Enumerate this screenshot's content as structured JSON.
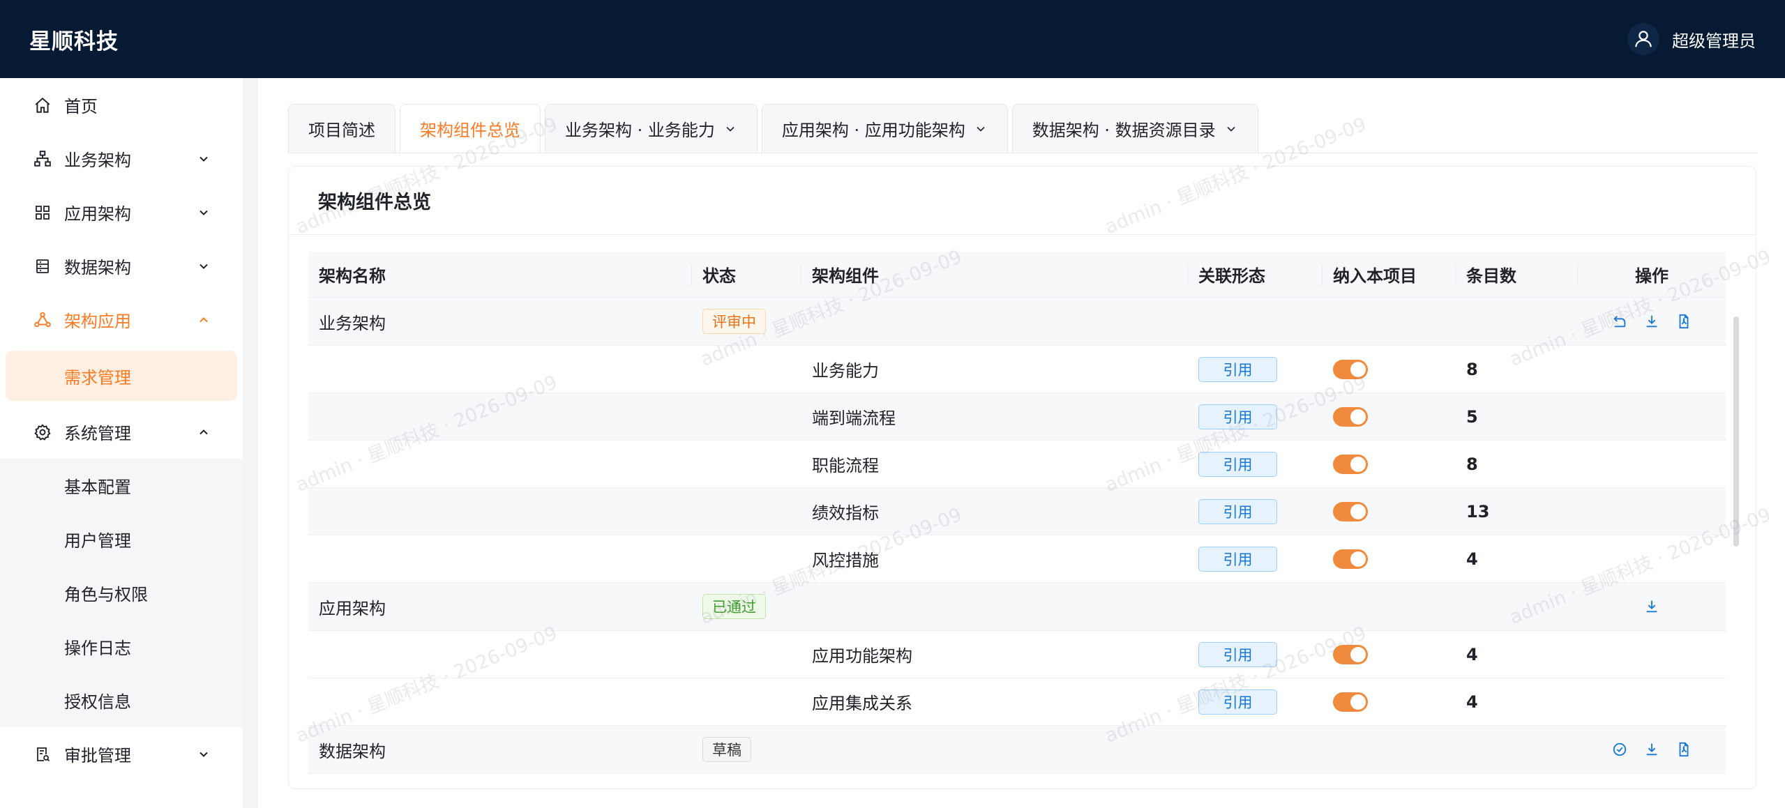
{
  "header": {
    "brand": "星顺科技",
    "user_name": "超级管理员"
  },
  "sidebar": {
    "items": [
      {
        "label": "首页",
        "icon": "home-icon"
      },
      {
        "label": "业务架构",
        "icon": "org-chart-icon"
      },
      {
        "label": "应用架构",
        "icon": "grid-icon"
      },
      {
        "label": "数据架构",
        "icon": "database-icon"
      },
      {
        "label": "架构应用",
        "icon": "share-nodes-icon"
      },
      {
        "label": "系统管理",
        "icon": "gear-icon"
      },
      {
        "label": "审批管理",
        "icon": "approval-icon"
      }
    ],
    "arch_app_children": [
      "需求管理"
    ],
    "system_children": [
      "基本配置",
      "用户管理",
      "角色与权限",
      "操作日志",
      "授权信息"
    ]
  },
  "tabs": [
    {
      "label": "项目简述"
    },
    {
      "label": "架构组件总览"
    },
    {
      "label": "业务架构 · 业务能力"
    },
    {
      "label": "应用架构 · 应用功能架构"
    },
    {
      "label": "数据架构 · 数据资源目录"
    }
  ],
  "card": {
    "title": "架构组件总览"
  },
  "table": {
    "headers": [
      "架构名称",
      "状态",
      "架构组件",
      "关联形态",
      "纳入本项目",
      "条目数",
      "操作"
    ],
    "groups": [
      {
        "name": "业务架构",
        "status": "评审中",
        "rows": [
          {
            "component": "业务能力",
            "relation": "引用",
            "included": true,
            "count": "8"
          },
          {
            "component": "端到端流程",
            "relation": "引用",
            "included": true,
            "count": "5"
          },
          {
            "component": "职能流程",
            "relation": "引用",
            "included": true,
            "count": "8"
          },
          {
            "component": "绩效指标",
            "relation": "引用",
            "included": true,
            "count": "13"
          },
          {
            "component": "风控措施",
            "relation": "引用",
            "included": true,
            "count": "4"
          }
        ]
      },
      {
        "name": "应用架构",
        "status": "已通过",
        "rows": [
          {
            "component": "应用功能架构",
            "relation": "引用",
            "included": true,
            "count": "4"
          },
          {
            "component": "应用集成关系",
            "relation": "引用",
            "included": true,
            "count": "4"
          }
        ]
      },
      {
        "name": "数据架构",
        "status": "草稿",
        "rows": []
      }
    ]
  },
  "watermark": "admin · 星顺科技 · 2026-09-09",
  "colors": {
    "header_bg": "#071a33",
    "accent": "#ff7a21",
    "link_blue": "#1677d8",
    "toggle_on": "#f08a3c"
  }
}
